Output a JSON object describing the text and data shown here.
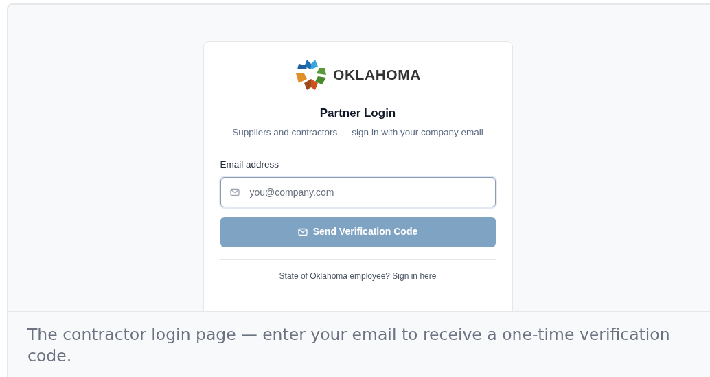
{
  "logo": {
    "wordmark": "OKLAHOMA"
  },
  "heading": "Partner Login",
  "subtitle": "Suppliers and contractors — sign in with your company email",
  "email_field": {
    "label": "Email address",
    "placeholder": "you@company.com",
    "focused": true
  },
  "submit_button": {
    "label": "Send Verification Code",
    "disabled": true
  },
  "employee_link": "State of Oklahoma employee? Sign in here",
  "caption": "The contractor login page — enter your email to receive a one-time verification code."
}
